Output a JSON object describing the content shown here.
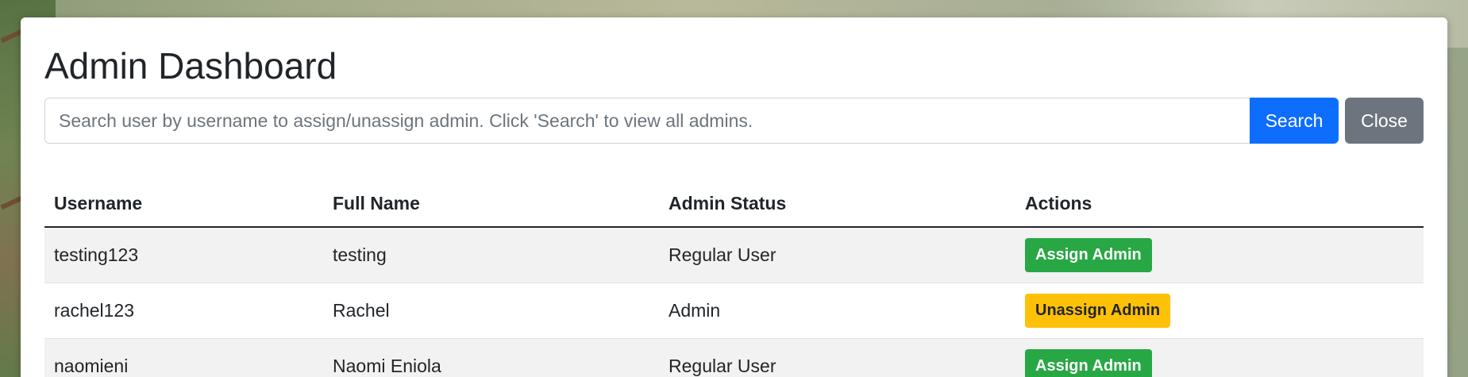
{
  "page": {
    "title": "Admin Dashboard"
  },
  "search": {
    "placeholder": "Search user by username to assign/unassign admin. Click 'Search' to view all admins.",
    "value": "",
    "search_label": "Search",
    "close_label": "Close"
  },
  "table": {
    "headers": [
      "Username",
      "Full Name",
      "Admin Status",
      "Actions"
    ],
    "rows": [
      {
        "username": "testing123",
        "full_name": "testing",
        "status": "Regular User",
        "action": "Assign Admin"
      },
      {
        "username": "rachel123",
        "full_name": "Rachel",
        "status": "Admin",
        "action": "Unassign Admin"
      },
      {
        "username": "naomieni",
        "full_name": "Naomi Eniola",
        "status": "Regular User",
        "action": "Assign Admin"
      }
    ]
  },
  "colors": {
    "primary": "#0d6efd",
    "secondary": "#6c757d",
    "success": "#28a745",
    "warning": "#ffc107"
  }
}
